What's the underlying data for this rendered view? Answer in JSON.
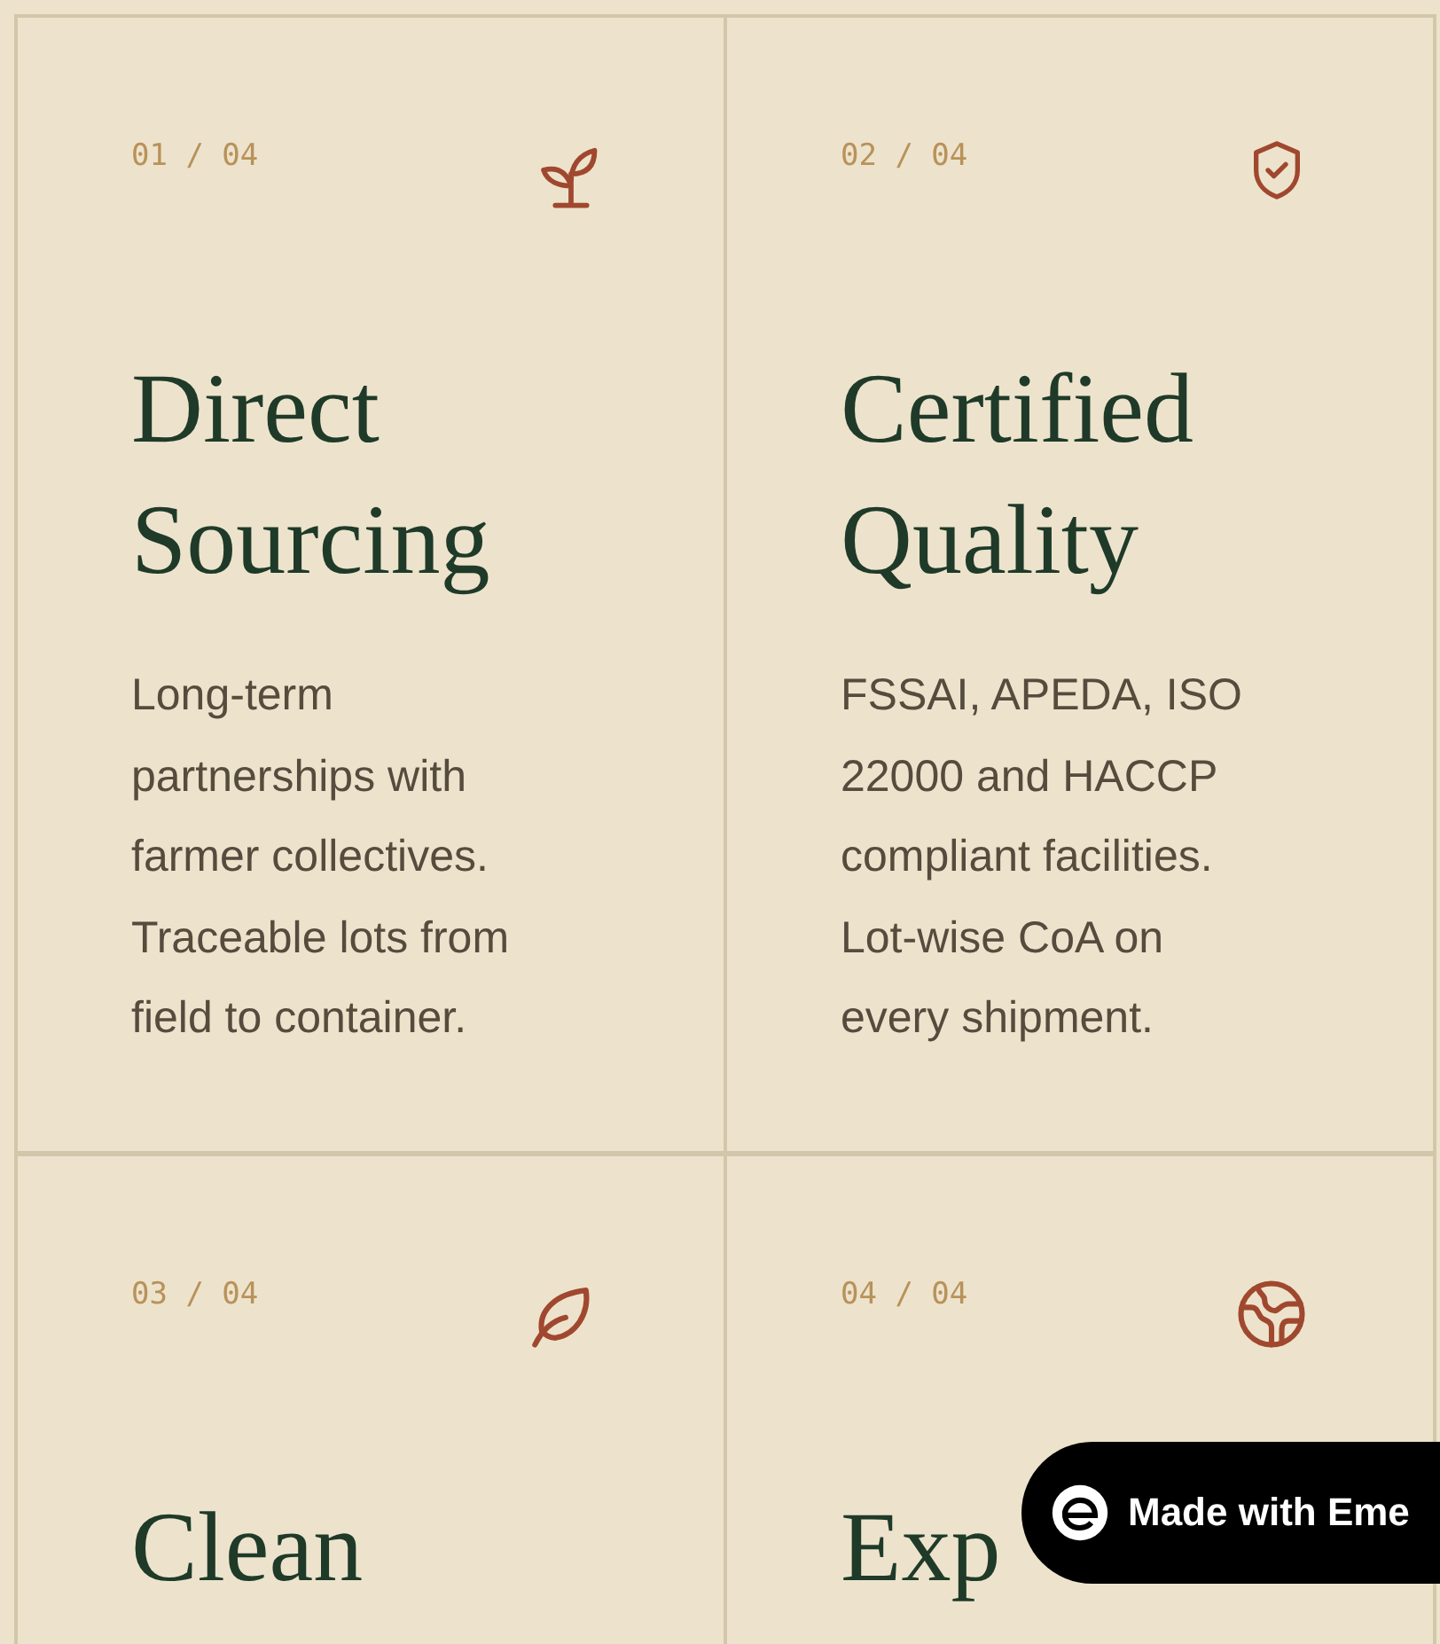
{
  "cards": [
    {
      "index": "01 / 04",
      "title": "Direct Sourcing",
      "body": "Long-term partnerships with farmer collectives. Traceable lots from field to container."
    },
    {
      "index": "02 / 04",
      "title": "Certified Quality",
      "body": "FSSAI, APEDA, ISO 22000 and HACCP compliant facilities. Lot-wise CoA on every shipment."
    },
    {
      "index": "03 / 04",
      "title": "Clean"
    },
    {
      "index": "04 / 04",
      "title": "Exp"
    }
  ],
  "badge": {
    "label": "Made with Eme"
  }
}
